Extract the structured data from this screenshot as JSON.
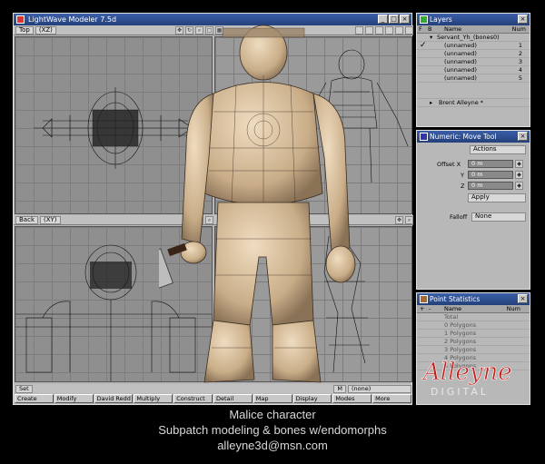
{
  "modeler": {
    "title": "LightWave Modeler 7.5d",
    "top_view": {
      "label": "Top",
      "mode": "(XZ)"
    },
    "back_view": {
      "label": "Back",
      "mode": "(XY)"
    },
    "persp_view": {
      "mode": "(none)"
    },
    "set_label": "Set",
    "m_label": "M",
    "none_label": "(none)",
    "menus": [
      "Create",
      "Modify",
      "David Redd",
      "Multiply",
      "Construct",
      "Detail",
      "Map",
      "Display",
      "Modes",
      "More"
    ]
  },
  "layers": {
    "title": "Layers",
    "headers": {
      "f": "F",
      "b": "B",
      "name": "Name",
      "num": "Num"
    },
    "root": "Servant_Yh_(bones0)",
    "items": [
      {
        "name": "(unnamed)",
        "num": "1",
        "checked": true
      },
      {
        "name": "(unnamed)",
        "num": "2",
        "checked": false
      },
      {
        "name": "(unnamed)",
        "num": "3",
        "checked": false
      },
      {
        "name": "(unnamed)",
        "num": "4",
        "checked": false
      },
      {
        "name": "(unnamed)",
        "num": "5",
        "checked": false
      }
    ],
    "footer": "Brent Alleyne *"
  },
  "numeric": {
    "title": "Numeric: Move Tool",
    "actions_label": "Actions",
    "offset_x_label": "Offset X",
    "y_label": "Y",
    "z_label": "Z",
    "x_value": "0 m",
    "y_value": "0 m",
    "z_value": "0 m",
    "apply_label": "Apply",
    "falloff_label": "Falloff",
    "falloff_value": "None"
  },
  "point_stats": {
    "title": "Point Statistics",
    "headers": {
      "plus": "+",
      "minus": "-",
      "name": "Name",
      "num": "Num"
    },
    "rows": [
      "Total",
      "0 Polygons",
      "1 Polygons",
      "2 Polygons",
      "3 Polygons",
      "4 Polygons",
      "5 Polygons"
    ]
  },
  "logo": {
    "name": "Alleyne",
    "sub": "DIGITAL"
  },
  "caption": {
    "line1": "Malice character",
    "line2": "Subpatch modeling & bones w/endomorphs",
    "line3": "alleyne3d@msn.com"
  },
  "colors": {
    "title_bar": "#23407a",
    "panel_bg": "#b8b8b8",
    "viewport_bg": "#8f8f8f",
    "logo_red": "#c0201c"
  }
}
